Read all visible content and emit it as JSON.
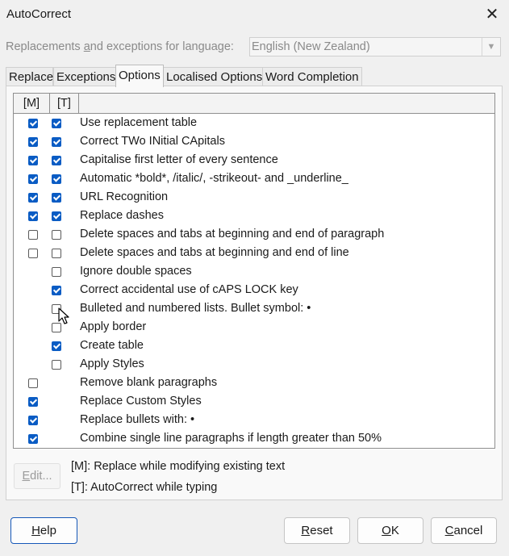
{
  "window": {
    "title": "AutoCorrect",
    "close_icon": "close-icon"
  },
  "language": {
    "label": "Replacements and exceptions for language:",
    "value": "English (New Zealand)"
  },
  "tabs": [
    {
      "label": "Replace"
    },
    {
      "label": "Exceptions"
    },
    {
      "label": "Options"
    },
    {
      "label": "Localised Options"
    },
    {
      "label": "Word Completion"
    }
  ],
  "active_tab": "Options",
  "list": {
    "header_m": "[M]",
    "header_t": "[T]",
    "rows": [
      {
        "label": "Use replacement table",
        "m": true,
        "t": true
      },
      {
        "label": "Correct TWo INitial CApitals",
        "m": true,
        "t": true
      },
      {
        "label": "Capitalise first letter of every sentence",
        "m": true,
        "t": true
      },
      {
        "label": "Automatic *bold*, /italic/, -strikeout- and _underline_",
        "m": true,
        "t": true
      },
      {
        "label": "URL Recognition",
        "m": true,
        "t": true
      },
      {
        "label": "Replace dashes",
        "m": true,
        "t": true
      },
      {
        "label": "Delete spaces and tabs at beginning and end of paragraph",
        "m": false,
        "t": false
      },
      {
        "label": "Delete spaces and tabs at beginning and end of line",
        "m": false,
        "t": false
      },
      {
        "label": "Ignore double spaces",
        "m": null,
        "t": false
      },
      {
        "label": "Correct accidental use of cAPS LOCK key",
        "m": null,
        "t": true
      },
      {
        "label": "Bulleted and numbered lists. Bullet symbol: •",
        "m": null,
        "t": false
      },
      {
        "label": "Apply border",
        "m": null,
        "t": false
      },
      {
        "label": "Create table",
        "m": null,
        "t": true
      },
      {
        "label": "Apply Styles",
        "m": null,
        "t": false
      },
      {
        "label": "Remove blank paragraphs",
        "m": false,
        "t": null
      },
      {
        "label": "Replace Custom Styles",
        "m": true,
        "t": null
      },
      {
        "label": "Replace bullets with: •",
        "m": true,
        "t": null
      },
      {
        "label": "Combine single line paragraphs if length greater than 50%",
        "m": true,
        "t": null
      }
    ]
  },
  "edit_button": "Edit...",
  "legend": {
    "m": "[M]: Replace while modifying existing text",
    "t": "[T]: AutoCorrect while typing"
  },
  "buttons": {
    "help": "Help",
    "reset": "Reset",
    "ok": "OK",
    "cancel": "Cancel"
  },
  "colors": {
    "checkbox_checked": "#0a5cc4",
    "default_button_border": "#1658b8"
  }
}
